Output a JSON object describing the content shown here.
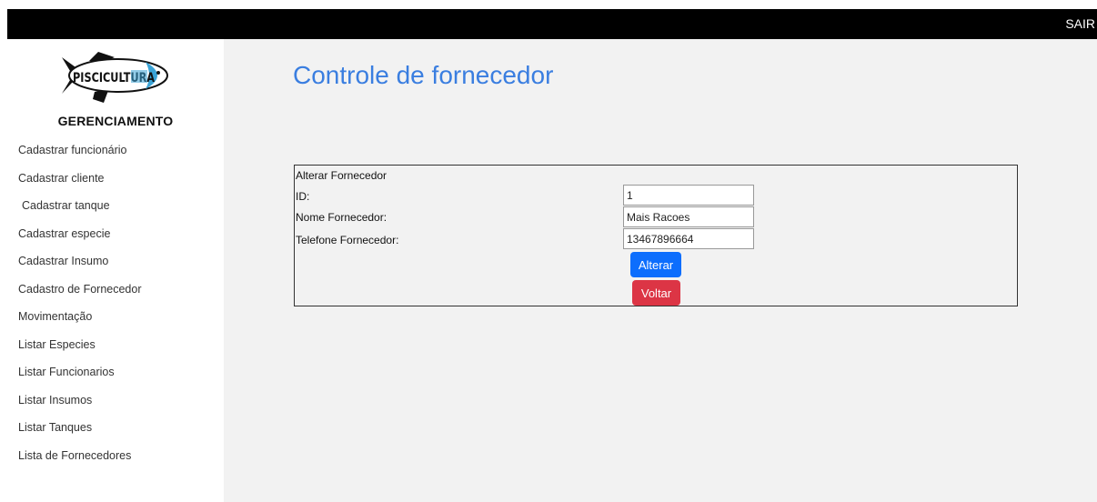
{
  "header": {
    "logout_label": "SAIR"
  },
  "sidebar": {
    "logo_text": "PISCICULTURA",
    "brand": "GERENCIAMENTO",
    "items": [
      {
        "label": "Cadastrar funcionário"
      },
      {
        "label": "Cadastrar cliente"
      },
      {
        "label": "Cadastrar tanque"
      },
      {
        "label": "Cadastrar especie"
      },
      {
        "label": "Cadastrar Insumo"
      },
      {
        "label": "Cadastro de Fornecedor"
      },
      {
        "label": "Movimentação"
      },
      {
        "label": "Listar Especies"
      },
      {
        "label": "Listar Funcionarios"
      },
      {
        "label": "Listar Insumos"
      },
      {
        "label": "Listar Tanques"
      },
      {
        "label": "Lista de Fornecedores"
      }
    ]
  },
  "main": {
    "title": "Controle de fornecedor",
    "form": {
      "title": "Alterar Fornecedor",
      "id_label": "ID:",
      "id_value": "1",
      "name_label": "Nome Fornecedor:",
      "name_value": "Mais Racoes",
      "phone_label": "Telefone Fornecedor:",
      "phone_value": "13467896664",
      "submit_label": "Alterar",
      "back_label": "Voltar"
    }
  },
  "colors": {
    "title": "#3a7ee0",
    "primary_button": "#0d6efd",
    "danger_button": "#dc3545",
    "topbar": "#000000",
    "main_bg": "#f2f2f2"
  }
}
